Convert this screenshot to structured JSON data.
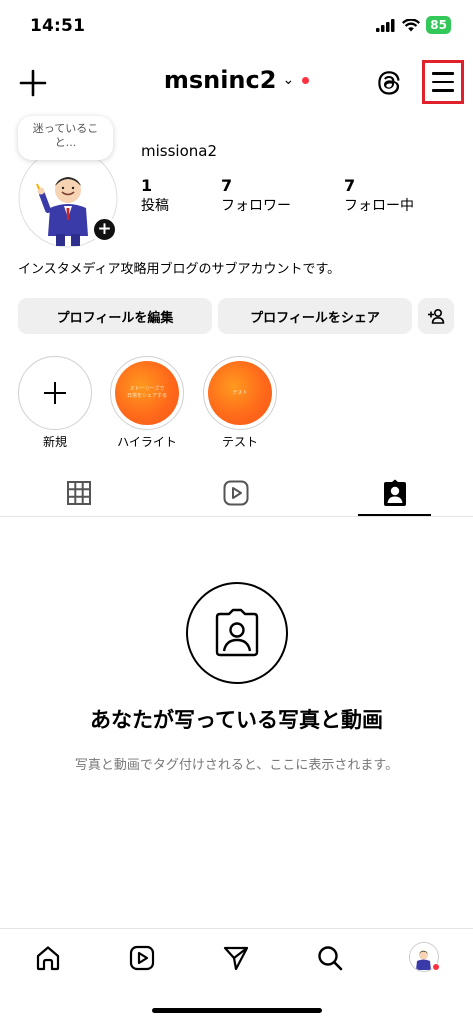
{
  "status_bar": {
    "time": "14:51",
    "battery": "85"
  },
  "header": {
    "username": "msninc2",
    "chevron": "⌄",
    "menu_icon": "hamburger-menu-icon",
    "threads_icon": "threads-icon",
    "create_icon": "plus-icon"
  },
  "profile": {
    "note": "迷っていること...",
    "display_name": "missiona2",
    "stats": [
      {
        "value": "1",
        "label": "投稿"
      },
      {
        "value": "7",
        "label": "フォロワー"
      },
      {
        "value": "7",
        "label": "フォロー中"
      }
    ],
    "bio": "インスタメディア攻略用ブログのサブアカウントです。"
  },
  "buttons": {
    "edit": "プロフィールを編集",
    "share": "プロフィールをシェア",
    "add_person_icon": "add-person-icon"
  },
  "highlights": [
    {
      "label": "新規"
    },
    {
      "label": "ハイライト",
      "cover_text": "ストーリーズで\n日常をシェアする"
    },
    {
      "label": "テスト",
      "cover_text": "テスト"
    }
  ],
  "tabs": [
    "grid-icon",
    "reels-icon",
    "tagged-icon"
  ],
  "active_tab": "tagged",
  "empty_state": {
    "title": "あなたが写っている写真と動画",
    "description": "写真と動画でタグ付けされると、ここに表示されます。"
  },
  "bottom_nav": [
    "home-icon",
    "reels-icon",
    "direct-icon",
    "search-icon",
    "profile-avatar"
  ],
  "colors": {
    "accent_red": "#ff3040",
    "highlight_orange": "#ff6a1a",
    "battery_green": "#34c759",
    "button_gray": "#efefef"
  }
}
